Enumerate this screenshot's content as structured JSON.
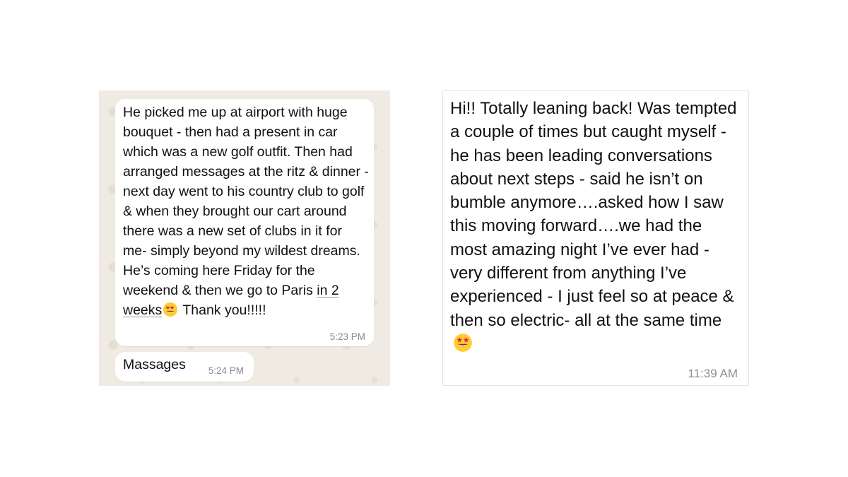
{
  "left_chat": {
    "message_1": {
      "text_before_link": "He picked me up at airport with huge bouquet - then had a present in car which was a new golf outfit. Then had arranged messages at the ritz & dinner - next day went to his country club to golf & when they brought our cart around there was a new set of clubs in it for me- simply beyond my wildest dreams. He’s coming here Friday for the weekend & then we go to Paris ",
      "link_text": "in 2 weeks",
      "emoji": "smiling-face-with-heart-eyes",
      "text_after_emoji": " Thank you!!!!!",
      "time": "5:23 PM"
    },
    "message_2": {
      "text": "Massages",
      "time": "5:24 PM"
    }
  },
  "right_chat": {
    "message": {
      "text": "Hi!! Totally leaning back!  Was tempted a couple of times but caught myself - he has been leading conversations about next steps - said he isn’t on bumble anymore….asked how I saw this moving forward….we had the most amazing night I’ve ever had - very different from anything I’ve experienced - I just feel so at peace & then so electric- all at the same time",
      "emoji": "star-struck",
      "time": "11:39 AM"
    }
  },
  "colors": {
    "whatsapp_background": "#efeae2",
    "bubble": "#ffffff",
    "timestamp": "#8a8a8a"
  }
}
